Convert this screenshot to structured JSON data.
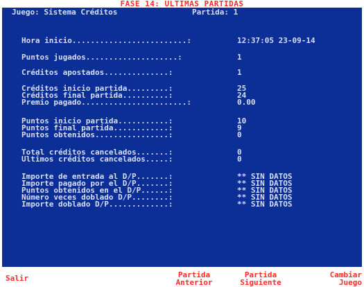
{
  "header": {
    "title": "FASE 14: ULTIMAS PARTIDAS",
    "game_label": "Juego: Sistema Créditos",
    "match_label": "Partida: 1"
  },
  "rows": [
    {
      "label": "Hora inicio.........................:",
      "value": "12:37:05 23-09-14"
    },
    {
      "label": "Puntos jugados....................:",
      "value": "1"
    },
    {
      "label": "Créditos apostados..............:",
      "value": "1"
    },
    {
      "label": "Créditos inicio partida.........:",
      "value": "25"
    },
    {
      "label": "Créditos final partida..........:",
      "value": "24"
    },
    {
      "label": "Premio pagado.......................:",
      "value": "0.00"
    },
    {
      "label": "Puntos inicio partida...........:",
      "value": "10"
    },
    {
      "label": "Puntos final partida............:",
      "value": "9"
    },
    {
      "label": "Puntos obtenidos................:",
      "value": "0"
    },
    {
      "label": "Total créditos cancelados.......:",
      "value": "0"
    },
    {
      "label": "Ultimos créditos cancelados.....:",
      "value": "0"
    },
    {
      "label": "Importe de entrada al D/P.......:",
      "value": "** SIN DATOS"
    },
    {
      "label": "Importe pagado por el D/P.......:",
      "value": "** SIN DATOS"
    },
    {
      "label": "Puntos obtenidos en el D/P......:",
      "value": "** SIN DATOS"
    },
    {
      "label": "Número veces doblado D/P........:",
      "value": "** SIN DATOS"
    },
    {
      "label": "Importe doblado D/P.............:",
      "value": "** SIN DATOS"
    }
  ],
  "footer": {
    "salir": "Salir",
    "prev_line1": "Partida",
    "prev_line2": "Anterior",
    "next_line1": "Partida",
    "next_line2": "Siguiente",
    "change_line1": "Cambiar",
    "change_line2": "Juego"
  },
  "colors": {
    "screen_bg": "#0b2f96",
    "text": "#d8def5",
    "accent": "#ff2a2a"
  }
}
